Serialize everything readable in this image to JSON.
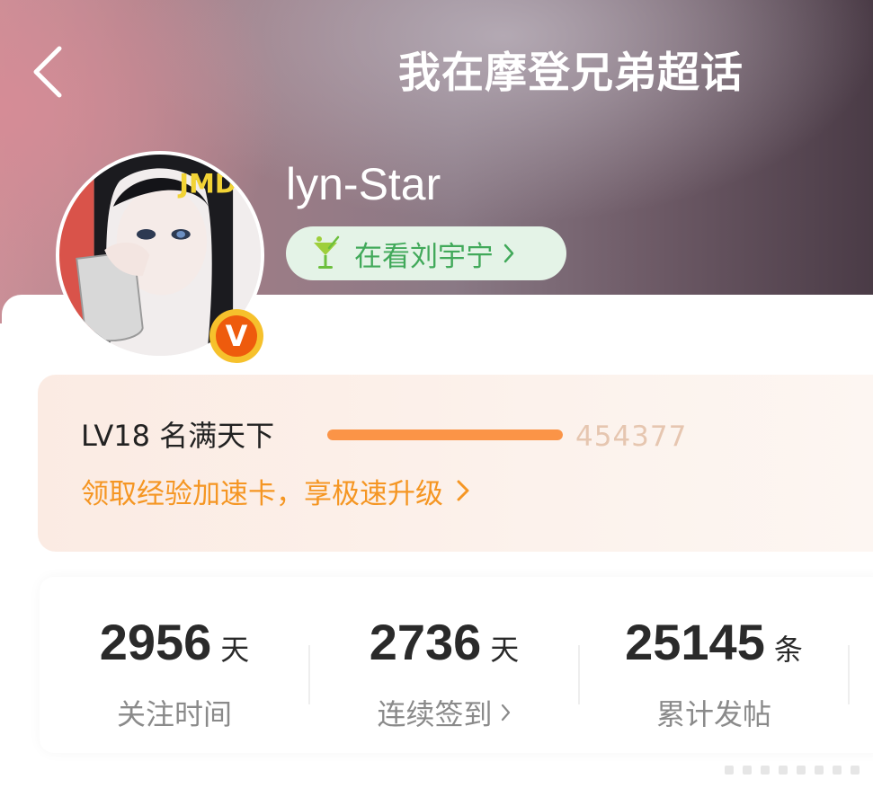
{
  "header": {
    "title": "我在摩登兄弟超话",
    "back_icon": "chevron-left-icon"
  },
  "profile": {
    "username": "lyn-Star",
    "avatar_caption": "JMD",
    "verified_badge": "V",
    "watching_label": "在看刘宇宁",
    "watching_icon": "cocktail-icon"
  },
  "level": {
    "title": "LV18 名满天下",
    "progress": 1.0,
    "exp": "454377",
    "promo_link": "领取经验加速卡，享极速升级"
  },
  "stats": [
    {
      "value": "2956",
      "unit": "天",
      "label": "关注时间"
    },
    {
      "value": "2736",
      "unit": "天",
      "label": "连续签到"
    },
    {
      "value": "25145",
      "unit": "条",
      "label": "累计发帖"
    }
  ],
  "colors": {
    "accent_orange": "#f59623",
    "progress": "#fb9447",
    "pill_green": "#41a95a",
    "badge_orange": "#ee5b0d",
    "badge_gold": "#f6c12c"
  }
}
